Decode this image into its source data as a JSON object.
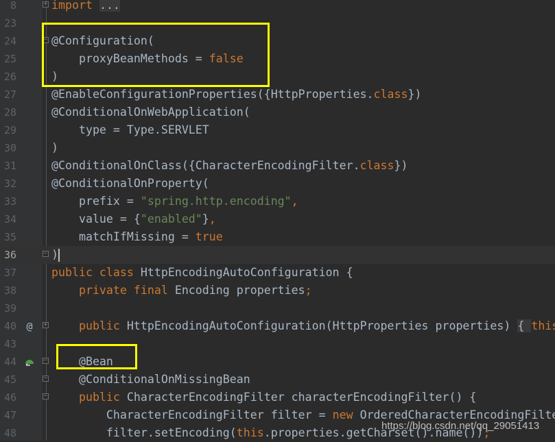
{
  "editor": {
    "theme_colors": {
      "background": "#2b2b2b",
      "keyword": "#cc7832",
      "string": "#6a8759",
      "text": "#a9b7c6",
      "highlight_box": "#ffff00"
    },
    "current_line": "36",
    "lines": [
      {
        "n": "8",
        "fold": "plus",
        "t": [
          [
            "kw",
            "import"
          ],
          [
            "p",
            " "
          ],
          [
            "fb",
            "..."
          ]
        ]
      },
      {
        "n": "23",
        "t": []
      },
      {
        "n": "24",
        "fold": "minus",
        "t": [
          [
            "p",
            "@Configuration("
          ]
        ]
      },
      {
        "n": "25",
        "t": [
          [
            "p",
            "    proxyBeanMethods = "
          ],
          [
            "kw",
            "false"
          ]
        ]
      },
      {
        "n": "26",
        "t": [
          [
            "p",
            ")"
          ]
        ]
      },
      {
        "n": "27",
        "t": [
          [
            "p",
            "@EnableConfigurationProperties({HttpProperties."
          ],
          [
            "kw",
            "class"
          ],
          [
            "p",
            "})"
          ]
        ]
      },
      {
        "n": "28",
        "t": [
          [
            "p",
            "@ConditionalOnWebApplication("
          ]
        ]
      },
      {
        "n": "29",
        "t": [
          [
            "p",
            "    type = Type.SERVLET"
          ]
        ]
      },
      {
        "n": "30",
        "t": [
          [
            "p",
            ")"
          ]
        ]
      },
      {
        "n": "31",
        "t": [
          [
            "p",
            "@ConditionalOnClass({CharacterEncodingFilter."
          ],
          [
            "kw",
            "class"
          ],
          [
            "p",
            "})"
          ]
        ]
      },
      {
        "n": "32",
        "t": [
          [
            "p",
            "@ConditionalOnProperty("
          ]
        ]
      },
      {
        "n": "33",
        "t": [
          [
            "p",
            "    prefix = "
          ],
          [
            "str",
            "\"spring.http.encoding\""
          ],
          [
            "kw",
            ","
          ]
        ]
      },
      {
        "n": "34",
        "t": [
          [
            "p",
            "    value = {"
          ],
          [
            "str",
            "\"enabled\""
          ],
          [
            "p",
            "}"
          ],
          [
            "kw",
            ","
          ]
        ]
      },
      {
        "n": "35",
        "t": [
          [
            "p",
            "    matchIfMissing = "
          ],
          [
            "kw",
            "true"
          ]
        ]
      },
      {
        "n": "36",
        "fold": "minus",
        "caret": true,
        "t": [
          [
            "p",
            ")"
          ]
        ]
      },
      {
        "n": "37",
        "t": [
          [
            "kw",
            "public class "
          ],
          [
            "p",
            "HttpEncodingAutoConfiguration {"
          ]
        ]
      },
      {
        "n": "38",
        "t": [
          [
            "kw",
            "    private final "
          ],
          [
            "p",
            "Encoding properties"
          ],
          [
            "kw",
            ";"
          ]
        ]
      },
      {
        "n": "39",
        "t": []
      },
      {
        "n": "40",
        "icon": "@",
        "fold": "plus",
        "t": [
          [
            "kw",
            "    public "
          ],
          [
            "p",
            "HttpEncodingAutoConfiguration(HttpProperties properties) "
          ],
          [
            "fb",
            "{ "
          ],
          [
            "kw",
            "this"
          ]
        ]
      },
      {
        "n": "43",
        "t": []
      },
      {
        "n": "44",
        "icon": "bean",
        "fold": "minus",
        "t": [
          [
            "p",
            "    @Bean"
          ]
        ]
      },
      {
        "n": "45",
        "fold": "minus",
        "t": [
          [
            "p",
            "    @ConditionalOnMissingBean"
          ]
        ]
      },
      {
        "n": "46",
        "fold": "minus",
        "t": [
          [
            "kw",
            "    public "
          ],
          [
            "p",
            "CharacterEncodingFilter characterEncodingFilter() {"
          ]
        ]
      },
      {
        "n": "47",
        "t": [
          [
            "p",
            "        CharacterEncodingFilter filter = "
          ],
          [
            "kw",
            "new "
          ],
          [
            "p",
            "OrderedCharacterEncodingFilter"
          ]
        ]
      },
      {
        "n": "48",
        "t": [
          [
            "p",
            "        filter.setEncoding("
          ],
          [
            "kw",
            "this"
          ],
          [
            "p",
            ".properties.getCharset().name())"
          ],
          [
            "kw",
            ";"
          ]
        ]
      }
    ]
  },
  "watermark": "https://blog.csdn.net/qq_29051413"
}
